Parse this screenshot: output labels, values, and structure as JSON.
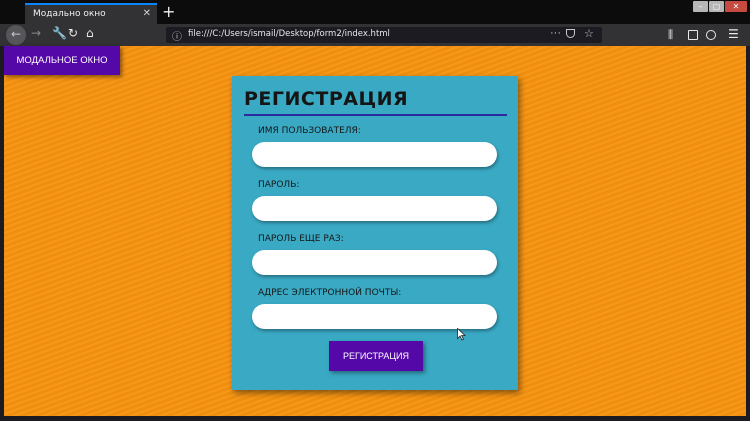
{
  "browser": {
    "tab_title": "Модально окно",
    "tab_close": "✕",
    "new_tab": "+",
    "window_min": "–",
    "window_max": "▢",
    "window_close": "✕",
    "url": "file:///C:/Users/ismail/Desktop/form2/index.html",
    "icons": [
      "back-icon",
      "forward-icon",
      "wrench-icon",
      "reload-icon",
      "home-icon",
      "info-icon",
      "more-icon",
      "pocket-icon",
      "star-icon",
      "library-icon",
      "sidebar-icon",
      "account-icon",
      "menu-icon"
    ]
  },
  "page": {
    "modal_button_label": "МОДАЛЬНОЕ ОКНО",
    "form": {
      "title": "РЕГИСТРАЦИЯ",
      "fields": [
        {
          "label": "ИМЯ ПОЛЬЗОВАТЕЛЯ:",
          "value": ""
        },
        {
          "label": "ПАРОЛЬ:",
          "value": ""
        },
        {
          "label": "ПАРОЛЬ ЕЩЕ РАЗ:",
          "value": ""
        },
        {
          "label": "АДРЕС ЭЛЕКТРОННОЙ ПОЧТЫ:",
          "value": ""
        }
      ],
      "submit_label": "РЕГИСТРАЦИЯ"
    }
  },
  "colors": {
    "background": "#f7930f",
    "form_card": "#3aa9c4",
    "button": "#5508a8",
    "title_underline": "#2b2ba0"
  }
}
